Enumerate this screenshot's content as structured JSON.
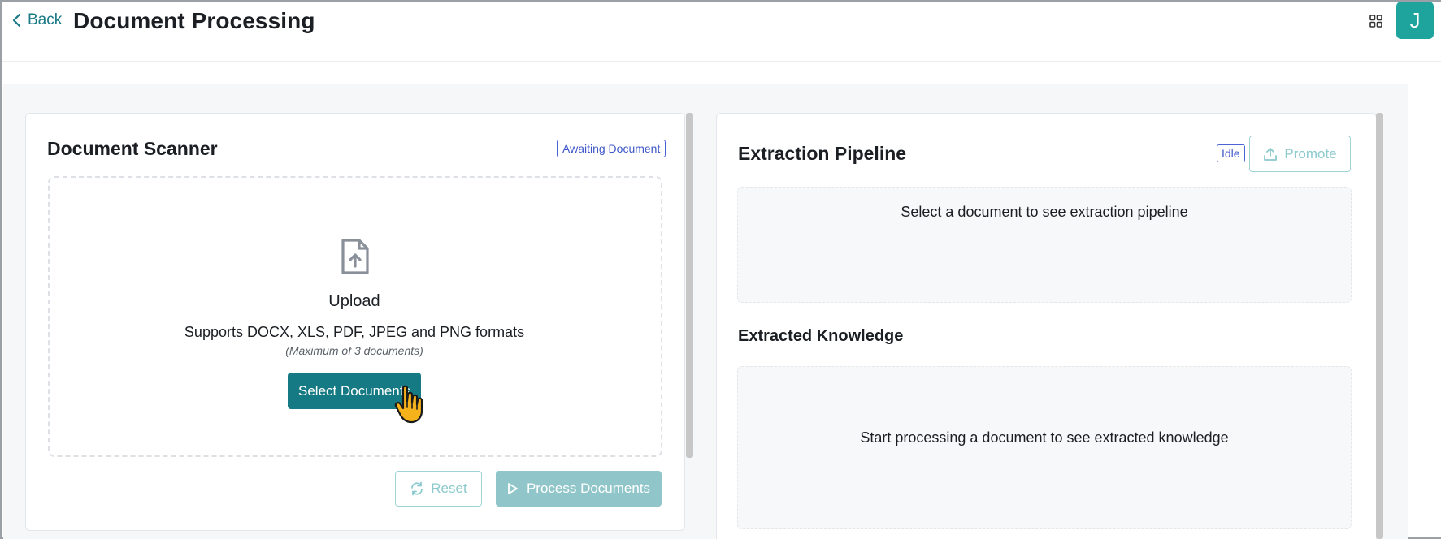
{
  "header": {
    "back_label": "Back",
    "title": "Document Processing",
    "apps_icon": "grid-icon",
    "avatar_initial": "J"
  },
  "scanner": {
    "title": "Document Scanner",
    "status_badge": "Awaiting Document",
    "upload_icon": "file-upload-icon",
    "upload_label": "Upload",
    "formats_text": "Supports DOCX, XLS, PDF, JPEG and PNG formats",
    "max_note": "(Maximum of 3 documents)",
    "select_button": "Select Documents",
    "reset_button": "Reset",
    "process_button": "Process Documents"
  },
  "pipeline": {
    "title": "Extraction Pipeline",
    "status_badge": "Idle",
    "promote_button": "Promote",
    "empty_text": "Select a document to see extraction pipeline"
  },
  "knowledge": {
    "title": "Extracted Knowledge",
    "empty_text": "Start processing a document to see extracted knowledge"
  },
  "colors": {
    "accent": "#167a84",
    "avatar": "#1ea39d",
    "badge_blue": "#3f57c8",
    "disabled_accent": "#90c6c9"
  }
}
